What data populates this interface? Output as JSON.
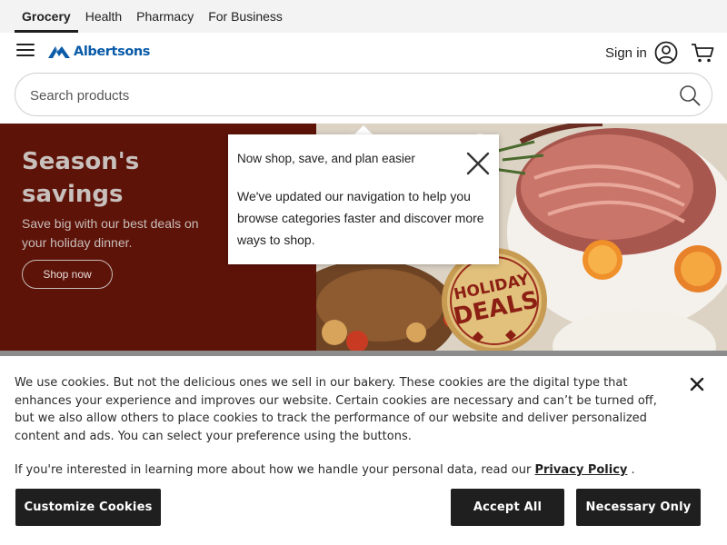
{
  "topnav": {
    "tabs": [
      "Grocery",
      "Health",
      "Pharmacy",
      "For Business"
    ],
    "active": "Grocery"
  },
  "header": {
    "logo_text": "Albertsons",
    "signin_label": "Sign in",
    "brand_color": "#0a5ba8"
  },
  "search": {
    "placeholder": "Search products",
    "value": ""
  },
  "hero": {
    "title": "Season's savings",
    "subtitle": "Save big with our best deals on your holiday dinner.",
    "button_label": "Shop now",
    "badge_line1": "HOLIDAY",
    "badge_line2": "DEALS",
    "panel_color": "#5e1309"
  },
  "tooltip": {
    "title": "Now shop, save, and plan easier",
    "body": "We've updated our navigation to help you browse categories faster and discover more ways to shop."
  },
  "cookie": {
    "text": "We use cookies. But not the delicious ones we sell in our bakery. These cookies are the digital type that enhances your experience and improves our website. Certain cookies are necessary and can’t be turned off, but we also allow others to place cookies to track the performance of our website and deliver personalized content and ads. You can select your preference using the buttons.",
    "policy_prefix": "If you're interested in learning more about how we handle your personal data, read our",
    "policy_link": "Privacy Policy",
    "policy_suffix": ".",
    "buttons": {
      "customize": "Customize Cookies",
      "accept": "Accept All",
      "necessary": "Necessary Only"
    }
  },
  "icons": [
    "hamburger-icon",
    "albertsons-logo-icon",
    "user-icon",
    "cart-icon",
    "search-icon",
    "close-icon"
  ]
}
